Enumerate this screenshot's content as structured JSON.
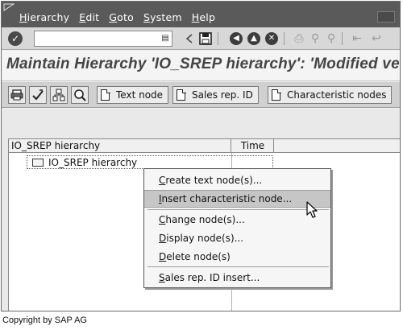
{
  "menubar": {
    "items": [
      {
        "mnemonic": "H",
        "rest": "ierarchy"
      },
      {
        "mnemonic": "E",
        "rest": "dit"
      },
      {
        "mnemonic": "G",
        "rest": "oto"
      },
      {
        "mnemonic": "S",
        "rest": "ystem"
      },
      {
        "mnemonic": "H",
        "rest": "elp"
      }
    ]
  },
  "stdbar": {
    "command_value": "",
    "icons": [
      "enter-checkmark-icon",
      "back-triangle-icon",
      "save-icon",
      "back-icon",
      "exit-icon",
      "cancel-icon",
      "print-icon",
      "find-icon",
      "find-next-icon",
      "first-page-icon",
      "previous-page-icon"
    ]
  },
  "title": {
    "text": "Maintain Hierarchy 'IO_SREP hierarchy': 'Modified ve"
  },
  "appbar": {
    "buttons": [
      {
        "label": "Text node"
      },
      {
        "label": "Sales rep. ID"
      },
      {
        "label": "Characteristic nodes"
      }
    ]
  },
  "tree": {
    "col_header_1": "IO_SREP hierarchy",
    "col_header_2": "Time",
    "root_node": "IO_SREP hierarchy"
  },
  "context_menu": {
    "items": [
      {
        "mn": "C",
        "rest": "reate text node(s)..."
      },
      {
        "mn": "I",
        "rest": "nsert characteristic node..."
      },
      {
        "mn": "C",
        "rest": "hange node(s)..."
      },
      {
        "mn": "D",
        "rest": "isplay node(s)..."
      },
      {
        "mn": "D",
        "rest": "elete node(s)"
      },
      {
        "mn": "S",
        "rest": "ales rep. ID insert..."
      }
    ],
    "highlighted_index": 1
  },
  "footer": {
    "copyright": "Copyright by SAP AG"
  },
  "colors": {
    "menubar_bg": "#5a5a5a",
    "toolbar_bg": "#d8d8d8",
    "highlight_bg": "#c6c6c6"
  }
}
